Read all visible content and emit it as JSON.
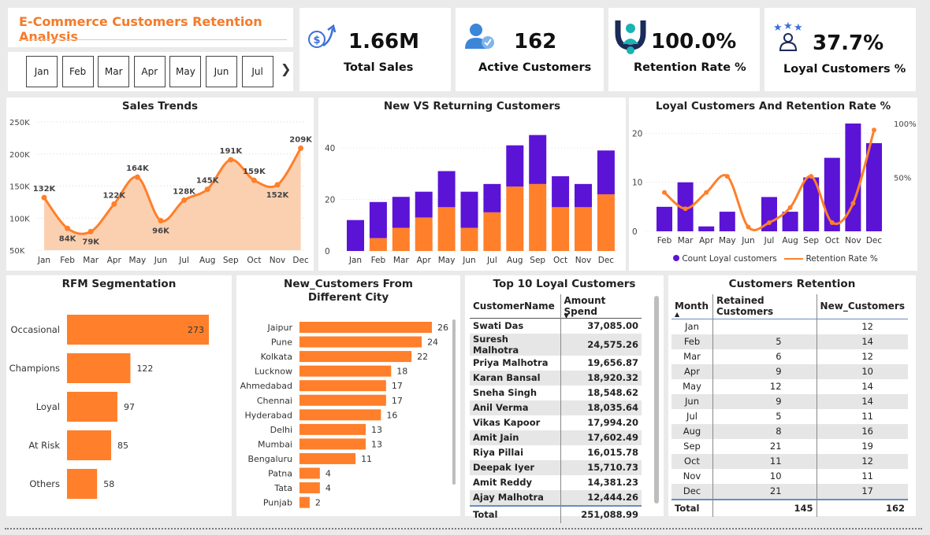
{
  "header": {
    "title": "E-Commerce Customers Retention Analysis"
  },
  "slicer": {
    "months": [
      "Jan",
      "Feb",
      "Mar",
      "Apr",
      "May",
      "Jun",
      "Jul"
    ],
    "next_icon": "chevron-right-icon"
  },
  "kpis": [
    {
      "value": "1.66M",
      "label": "Total Sales",
      "icon": "sales-growth-icon"
    },
    {
      "value": "162",
      "label": "Active Customers",
      "icon": "user-check-icon"
    },
    {
      "value": "100.0%",
      "label": "Retention Rate %",
      "icon": "retention-magnet-icon"
    },
    {
      "value": "37.7%",
      "label": "Loyal Customers %",
      "icon": "loyal-stars-icon"
    }
  ],
  "colors": {
    "orange": "#ff7f2a",
    "purple": "#5b13d6",
    "area": "#fbd0b0"
  },
  "sales_trend": {
    "title": "Sales Trends",
    "chart_data": {
      "type": "area",
      "x": [
        "Jan",
        "Feb",
        "Mar",
        "Apr",
        "May",
        "Jun",
        "Jul",
        "Aug",
        "Sep",
        "Oct",
        "Nov",
        "Dec"
      ],
      "values": [
        132,
        84,
        79,
        122,
        164,
        96,
        128,
        145,
        191,
        159,
        152,
        209
      ],
      "data_labels": [
        "132K",
        "84K",
        "79K",
        "122K",
        "164K",
        "96K",
        "128K",
        "145K",
        "191K",
        "159K",
        "152K",
        "209K"
      ],
      "y_ticks": [
        "250K",
        "200K",
        "150K",
        "100K",
        "50K"
      ],
      "ylim": [
        50,
        250
      ]
    }
  },
  "new_vs_returning": {
    "title": "New VS Returning Customers",
    "chart_data": {
      "type": "bar",
      "categories": [
        "Jan",
        "Feb",
        "Mar",
        "Apr",
        "May",
        "Jun",
        "Jul",
        "Aug",
        "Sep",
        "Oct",
        "Nov",
        "Dec"
      ],
      "series": [
        {
          "values": [
            0,
            5,
            9,
            13,
            17,
            9,
            15,
            25,
            26,
            17,
            17,
            22
          ]
        },
        {
          "values": [
            12,
            14,
            12,
            10,
            14,
            14,
            11,
            16,
            19,
            12,
            9,
            17
          ]
        }
      ],
      "y_ticks": [
        "40",
        "20",
        "0"
      ],
      "ylim": [
        0,
        48
      ]
    }
  },
  "loyal_retention": {
    "title": "Loyal Customers And Retention Rate %",
    "chart_data": {
      "type": "bar",
      "categories": [
        "Feb",
        "Mar",
        "Apr",
        "May",
        "Jun",
        "Jul",
        "Aug",
        "Sep",
        "Oct",
        "Nov",
        "Dec"
      ],
      "series": [
        {
          "name": "Count Loyal customers",
          "values": [
            5,
            10,
            1,
            4,
            0,
            7,
            4,
            11,
            15,
            22,
            18
          ]
        },
        {
          "name": "Retention Rate %",
          "values": [
            36,
            21,
            36,
            51,
            4,
            8,
            22,
            51,
            8,
            26,
            94
          ]
        }
      ],
      "y_ticks_left": [
        "20",
        "10",
        "0"
      ],
      "y_ticks_right": [
        "100%",
        "50%"
      ],
      "ylim_left": [
        0,
        22
      ],
      "ylim_right": [
        0,
        100
      ]
    },
    "legend": [
      "Count Loyal customers",
      "Retention Rate %"
    ]
  },
  "rfm": {
    "title": "RFM Segmentation",
    "chart_data": {
      "type": "bar",
      "categories": [
        "Occasional",
        "Champions",
        "Loyal",
        "At Risk",
        "Others"
      ],
      "values": [
        273,
        122,
        97,
        85,
        58
      ]
    }
  },
  "cities": {
    "title": "New_Customers From Different City",
    "chart_data": {
      "type": "bar",
      "categories": [
        "Jaipur",
        "Pune",
        "Kolkata",
        "Lucknow",
        "Ahmedabad",
        "Chennai",
        "Hyderabad",
        "Delhi",
        "Mumbai",
        "Bengaluru",
        "Patna",
        "Tata",
        "Punjab"
      ],
      "values": [
        26,
        24,
        22,
        18,
        17,
        17,
        16,
        13,
        13,
        11,
        4,
        4,
        2
      ]
    }
  },
  "top_loyal": {
    "title": "Top 10 Loyal Customers",
    "columns": [
      "CustomerName",
      "Amount Spend"
    ],
    "rows": [
      [
        "Swati Das",
        "37,085.00"
      ],
      [
        "Suresh Malhotra",
        "24,575.26"
      ],
      [
        "Priya Malhotra",
        "19,656.87"
      ],
      [
        "Karan Bansal",
        "18,920.32"
      ],
      [
        "Sneha Singh",
        "18,548.62"
      ],
      [
        "Anil Verma",
        "18,035.64"
      ],
      [
        "Vikas Kapoor",
        "17,994.20"
      ],
      [
        "Amit Jain",
        "17,602.49"
      ],
      [
        "Riya Pillai",
        "16,015.78"
      ],
      [
        "Deepak Iyer",
        "15,710.73"
      ],
      [
        "Amit Reddy",
        "14,381.23"
      ],
      [
        "Ajay Malhotra",
        "12,444.26"
      ]
    ],
    "total_label": "Total",
    "total_value": "251,088.99"
  },
  "retention_table": {
    "title": "Customers Retention",
    "columns": [
      "Month",
      "Retained Customers",
      "New_Customers"
    ],
    "rows": [
      [
        "Jan",
        "",
        "12"
      ],
      [
        "Feb",
        "5",
        "14"
      ],
      [
        "Mar",
        "6",
        "12"
      ],
      [
        "Apr",
        "9",
        "10"
      ],
      [
        "May",
        "12",
        "14"
      ],
      [
        "Jun",
        "9",
        "14"
      ],
      [
        "Jul",
        "5",
        "11"
      ],
      [
        "Aug",
        "8",
        "16"
      ],
      [
        "Sep",
        "21",
        "19"
      ],
      [
        "Oct",
        "11",
        "12"
      ],
      [
        "Nov",
        "10",
        "11"
      ],
      [
        "Dec",
        "21",
        "17"
      ]
    ],
    "total": [
      "Total",
      "145",
      "162"
    ]
  }
}
